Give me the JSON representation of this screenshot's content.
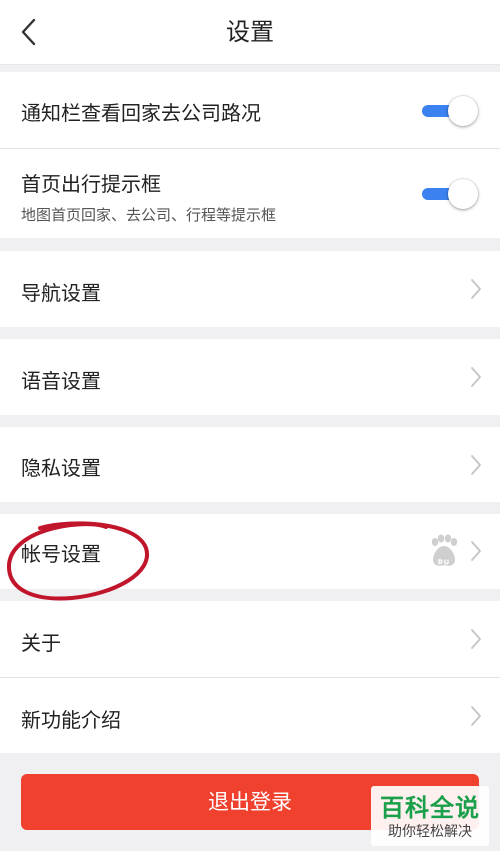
{
  "header": {
    "title": "设置"
  },
  "toggles": [
    {
      "label": "通知栏查看回家去公司路况",
      "on": true
    },
    {
      "label": "首页出行提示框",
      "sublabel": "地图首页回家、去公司、行程等提示框",
      "on": true
    }
  ],
  "menu": {
    "navigation": "导航设置",
    "voice": "语音设置",
    "privacy": "隐私设置",
    "account": "帐号设置",
    "about": "关于",
    "whats_new": "新功能介绍"
  },
  "logout_label": "退出登录",
  "watermark": {
    "title": "百科全说",
    "subtitle": "助你轻松解决"
  },
  "colors": {
    "accent": "#3b82f0",
    "danger": "#f0412f",
    "highlight_circle": "#c0152a",
    "watermark": "#1aa04a"
  }
}
